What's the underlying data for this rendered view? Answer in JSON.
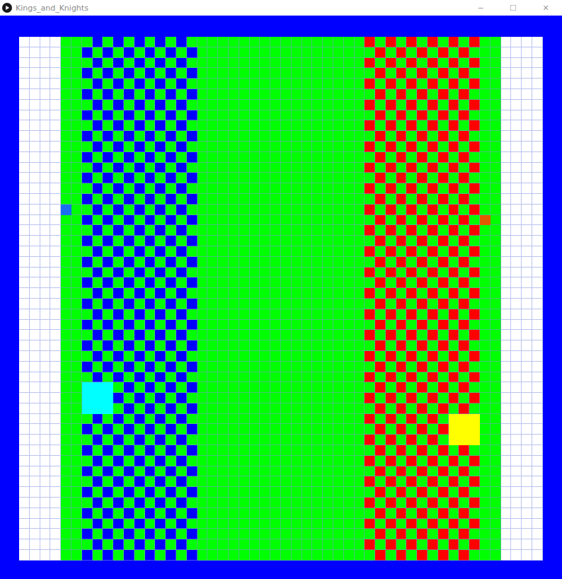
{
  "window": {
    "title": "Kings_and_Knights",
    "buttons": [
      "─",
      "☐",
      "✕"
    ]
  },
  "board": {
    "rows": 50,
    "cols": 50,
    "zones": [
      {
        "kind": "empty",
        "span": 4,
        "color": "#ffffff"
      },
      {
        "kind": "field",
        "span": 2,
        "color": "#00ff00"
      },
      {
        "kind": "checker",
        "span": 11,
        "color": "#0000ff"
      },
      {
        "kind": "field",
        "span": 16,
        "color": "#00ff00"
      },
      {
        "kind": "checker",
        "span": 11,
        "color": "#ff0000"
      },
      {
        "kind": "field",
        "span": 2,
        "color": "#00ff00"
      },
      {
        "kind": "empty",
        "span": 4,
        "color": "#ffffff"
      }
    ]
  },
  "pieces": [
    {
      "row": 16,
      "col": 4,
      "size": 1,
      "color": "#1a6ff0"
    },
    {
      "row": 17,
      "col": 44,
      "size": 1,
      "color": "#e05a00"
    },
    {
      "row": 33,
      "col": 6,
      "size": 3,
      "color": "#00ffff"
    },
    {
      "row": 36,
      "col": 41,
      "size": 3,
      "color": "#ffff00"
    }
  ]
}
